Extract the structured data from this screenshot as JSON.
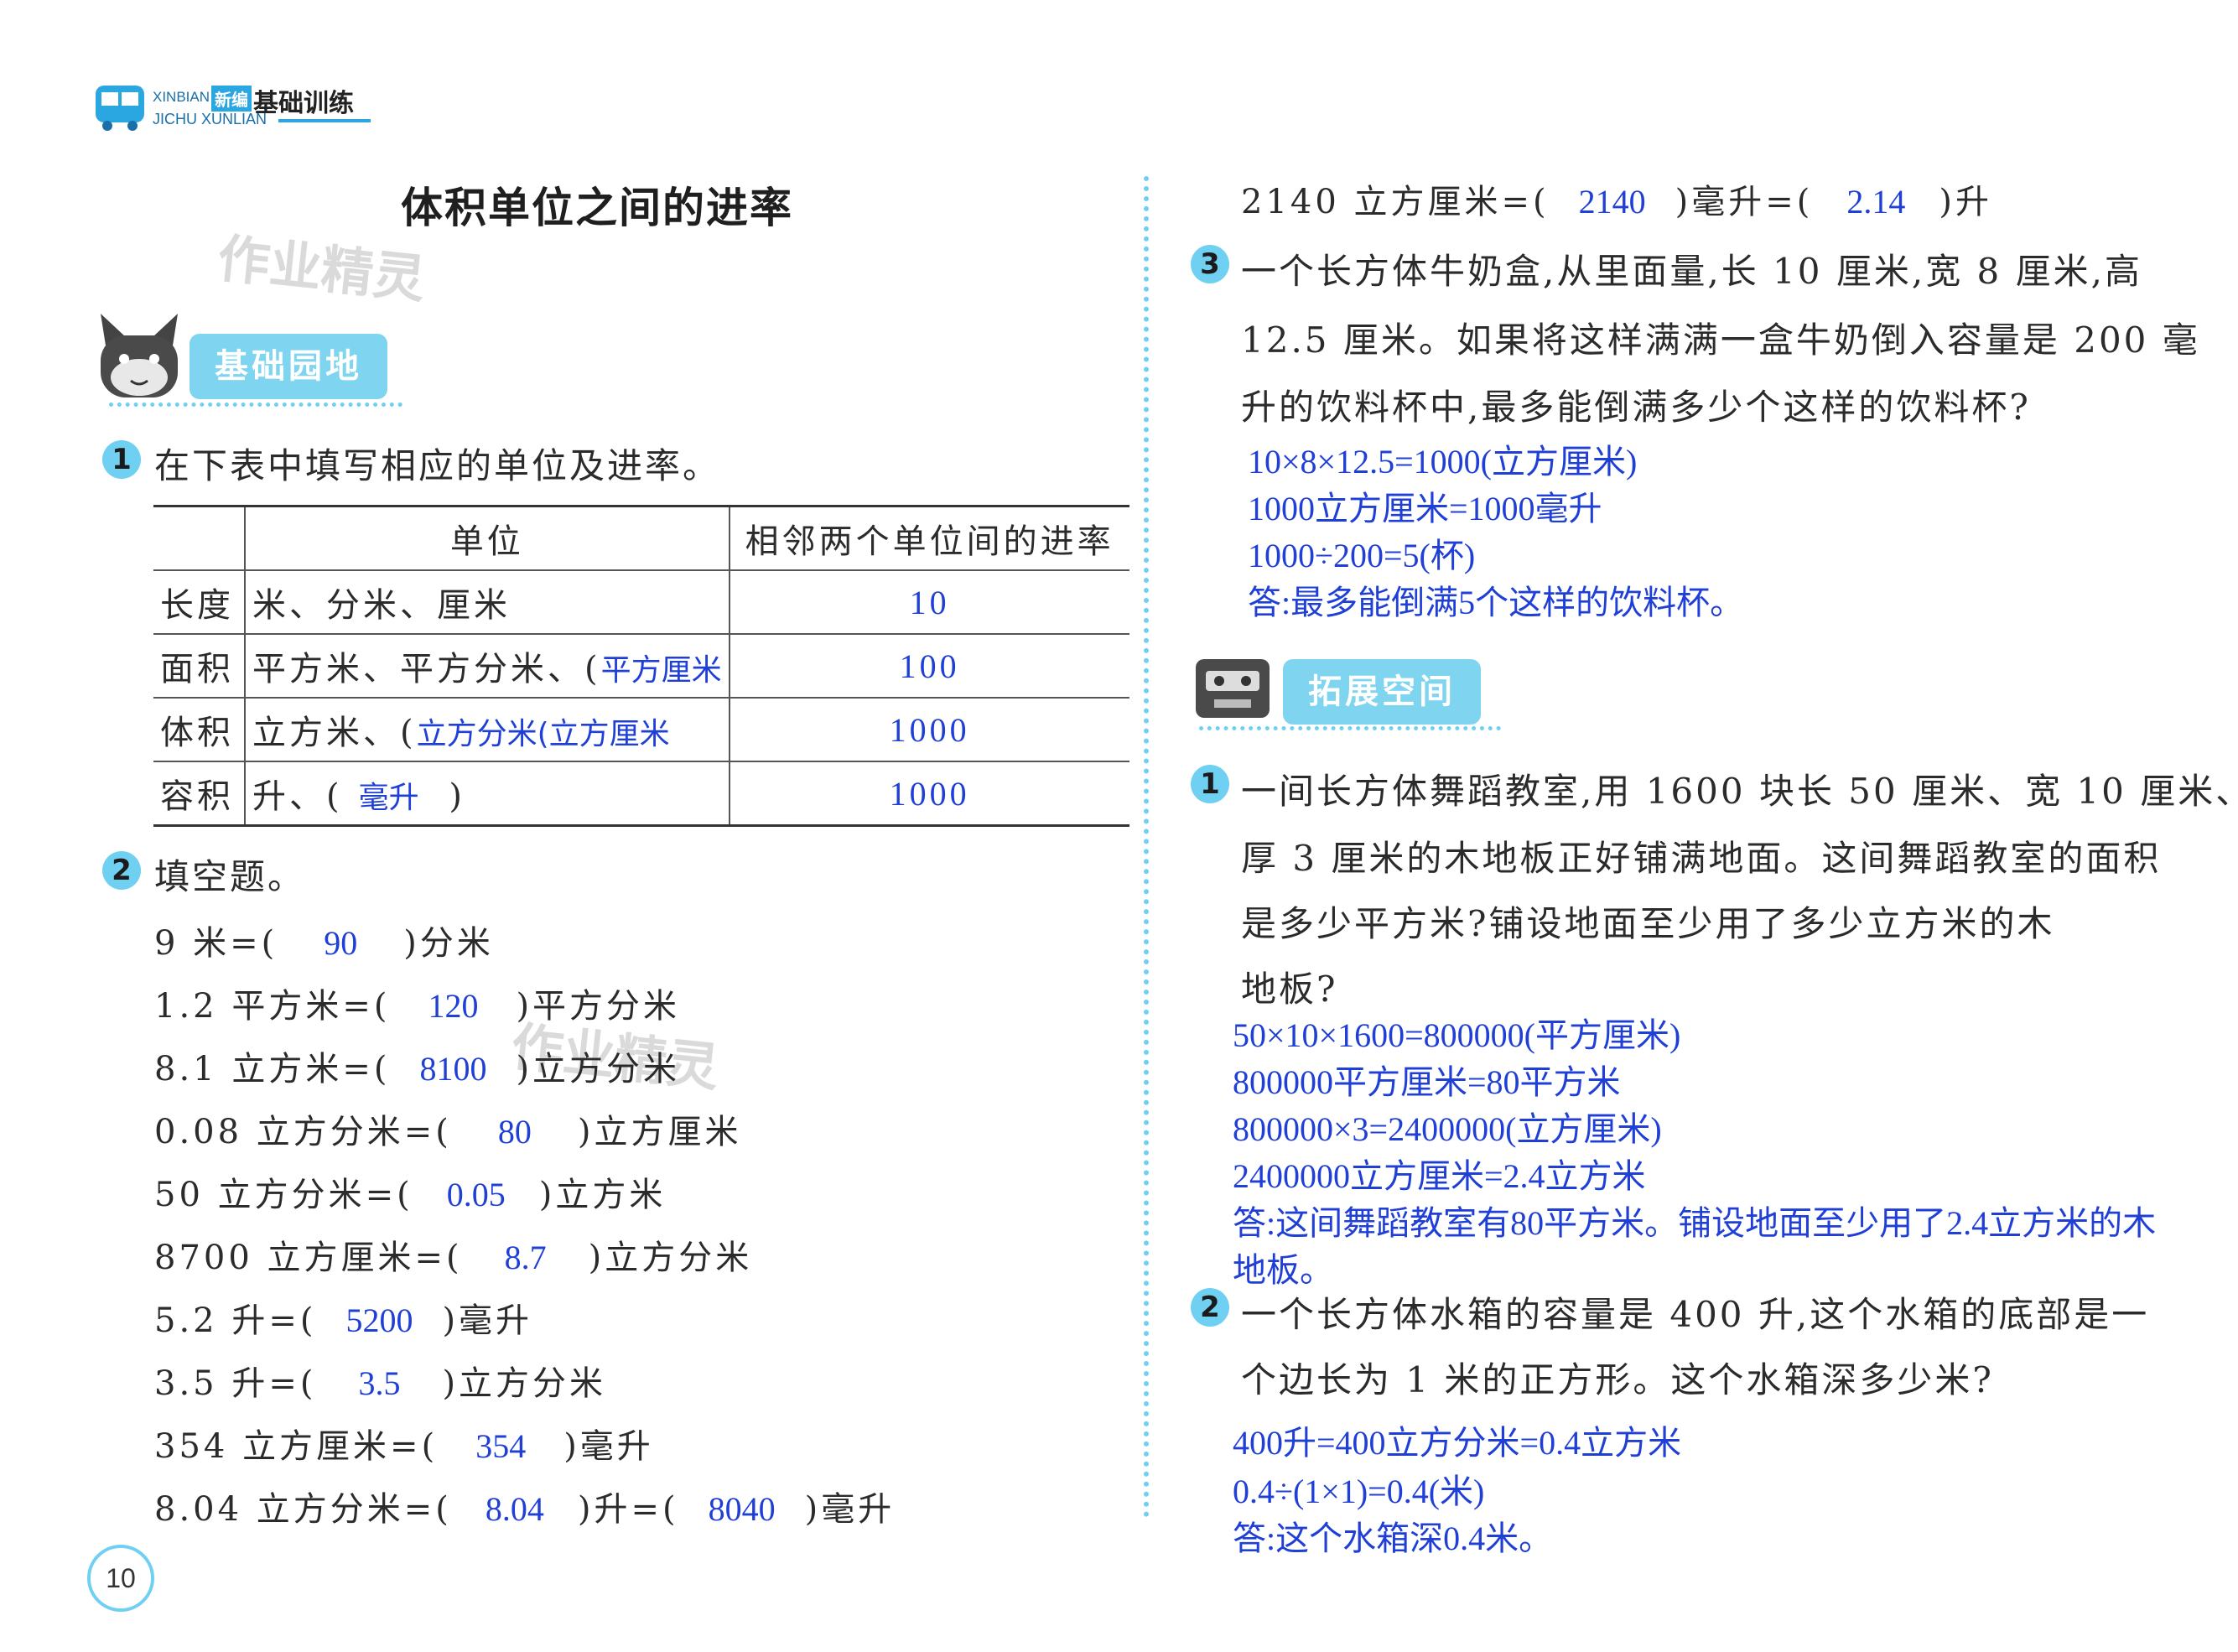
{
  "header": {
    "brand_pinyin_top": "XINBIAN",
    "brand_tag": "新编",
    "brand_title": "基础训练",
    "brand_pinyin_bottom": "JICHU XUNLIAN"
  },
  "watermark": "作业精灵",
  "title": "体积单位之间的进率",
  "left": {
    "section1": "基础园地",
    "q1": {
      "num": "1",
      "text": "在下表中填写相应的单位及进率。",
      "table": {
        "headers": [
          "",
          "单位",
          "相邻两个单位间的进率"
        ],
        "rows": [
          {
            "kind": "长度",
            "units": "米、分米、厘米",
            "fill": "",
            "rate": "10"
          },
          {
            "kind": "面积",
            "units": "平方米、平方分米、(",
            "fill": "平方厘米",
            "rate": "100"
          },
          {
            "kind": "体积",
            "units": "立方米、(",
            "fill": "立方分米(立方厘米",
            "rate": "1000"
          },
          {
            "kind": "容积",
            "units": "升、(",
            "fill": "毫升",
            "units_after": " )",
            "rate": "1000"
          }
        ]
      }
    },
    "q2": {
      "num": "2",
      "text": "填空题。",
      "lines": [
        {
          "a": "9 米=(",
          "v": "90",
          "b": ")分米"
        },
        {
          "a": "1.2 平方米=(",
          "v": "120",
          "b": ")平方分米"
        },
        {
          "a": "8.1 立方米=(",
          "v": "8100",
          "b": ")立方分米"
        },
        {
          "a": "0.08 立方分米=(",
          "v": "80",
          "b": ")立方厘米"
        },
        {
          "a": "50 立方分米=(",
          "v": "0.05",
          "b": ")立方米"
        },
        {
          "a": "8700 立方厘米=(",
          "v": "8.7",
          "b": ")立方分米"
        },
        {
          "a": "5.2 升=(",
          "v": "5200",
          "b": ")毫升"
        },
        {
          "a": "3.5 升=(",
          "v": "3.5",
          "b": ")立方分米"
        },
        {
          "a": "354 立方厘米=(",
          "v": "354",
          "b": ")毫升"
        },
        {
          "a": "8.04 立方分米=(",
          "v": "8.04",
          "b": ")升=(",
          "v2": "8040",
          "c": ")毫升"
        }
      ]
    },
    "page_number": "10"
  },
  "right": {
    "cont_line": {
      "a": "2140 立方厘米=(",
      "v": "2140",
      "b": ")毫升=(",
      "v2": "2.14",
      "c": ")升"
    },
    "q3": {
      "num": "3",
      "lines": [
        "一个长方体牛奶盒,从里面量,长 10 厘米,宽 8 厘米,高",
        "12.5 厘米。如果将这样满满一盒牛奶倒入容量是 200 毫",
        "升的饮料杯中,最多能倒满多少个这样的饮料杯?"
      ],
      "answers": [
        "10×8×12.5=1000(立方厘米)",
        "1000立方厘米=1000毫升",
        "1000÷200=5(杯)",
        "答:最多能倒满5个这样的饮料杯。"
      ]
    },
    "section2": "拓展空间",
    "e1": {
      "num": "1",
      "lines": [
        "一间长方体舞蹈教室,用 1600 块长 50 厘米、宽 10 厘米、",
        "厚 3 厘米的木地板正好铺满地面。这间舞蹈教室的面积",
        "是多少平方米?铺设地面至少用了多少立方米的木",
        "地板?"
      ],
      "answers": [
        "50×10×1600=800000(平方厘米)",
        "800000平方厘米=80平方米",
        "800000×3=2400000(立方厘米)",
        "2400000立方厘米=2.4立方米",
        "答:这间舞蹈教室有80平方米。铺设地面至少用了2.4立方米的木",
        "地板。"
      ]
    },
    "e2": {
      "num": "2",
      "lines": [
        "一个长方体水箱的容量是 400 升,这个水箱的底部是一",
        "个边长为 1 米的正方形。这个水箱深多少米?"
      ],
      "answers": [
        "400升=400立方分米=0.4立方米",
        "0.4÷(1×1)=0.4(米)",
        "答:这个水箱深0.4米。"
      ]
    }
  },
  "colors": {
    "accent": "#6fd0f2",
    "answer": "#1f3fd6"
  }
}
